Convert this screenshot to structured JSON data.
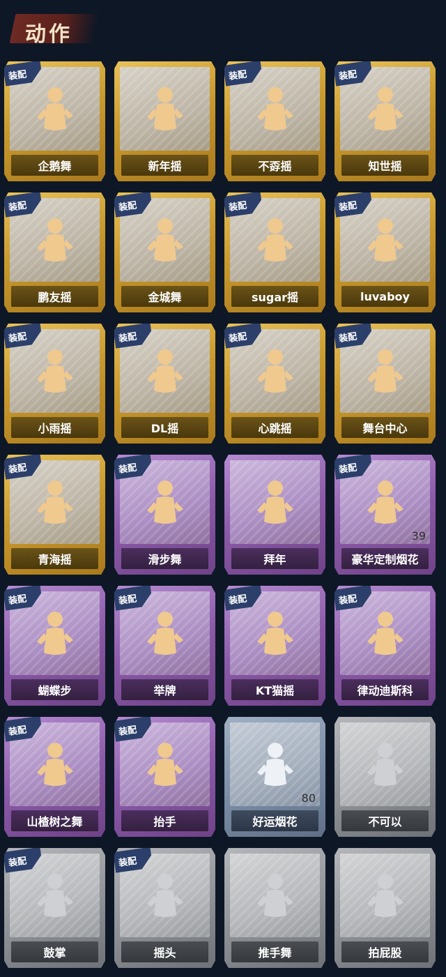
{
  "header": {
    "title": "动作"
  },
  "badge_text": "装配",
  "cards": [
    {
      "label": "企鹅舞",
      "rarity": "gold",
      "equipped": true,
      "count": ""
    },
    {
      "label": "新年摇",
      "rarity": "gold",
      "equipped": false,
      "count": ""
    },
    {
      "label": "不孬摇",
      "rarity": "gold",
      "equipped": true,
      "count": ""
    },
    {
      "label": "知世摇",
      "rarity": "gold",
      "equipped": true,
      "count": ""
    },
    {
      "label": "鹏友摇",
      "rarity": "gold",
      "equipped": true,
      "count": ""
    },
    {
      "label": "金城舞",
      "rarity": "gold",
      "equipped": true,
      "count": ""
    },
    {
      "label": "sugar摇",
      "rarity": "gold",
      "equipped": true,
      "count": ""
    },
    {
      "label": "luvaboy",
      "rarity": "gold",
      "equipped": true,
      "count": ""
    },
    {
      "label": "小雨摇",
      "rarity": "gold",
      "equipped": true,
      "count": ""
    },
    {
      "label": "DL摇",
      "rarity": "gold",
      "equipped": true,
      "count": ""
    },
    {
      "label": "心跳摇",
      "rarity": "gold",
      "equipped": true,
      "count": ""
    },
    {
      "label": "舞台中心",
      "rarity": "gold",
      "equipped": true,
      "count": ""
    },
    {
      "label": "青海摇",
      "rarity": "gold",
      "equipped": true,
      "count": ""
    },
    {
      "label": "滑步舞",
      "rarity": "purple",
      "equipped": true,
      "count": ""
    },
    {
      "label": "拜年",
      "rarity": "purple",
      "equipped": false,
      "count": ""
    },
    {
      "label": "豪华定制烟花",
      "rarity": "purple",
      "equipped": true,
      "count": "39"
    },
    {
      "label": "蝴蝶步",
      "rarity": "purple",
      "equipped": true,
      "count": ""
    },
    {
      "label": "举牌",
      "rarity": "purple",
      "equipped": true,
      "count": ""
    },
    {
      "label": "KT猫摇",
      "rarity": "purple",
      "equipped": true,
      "count": ""
    },
    {
      "label": "律动迪斯科",
      "rarity": "purple",
      "equipped": true,
      "count": ""
    },
    {
      "label": "山楂树之舞",
      "rarity": "purple",
      "equipped": true,
      "count": ""
    },
    {
      "label": "抬手",
      "rarity": "purple",
      "equipped": true,
      "count": ""
    },
    {
      "label": "好运烟花",
      "rarity": "blue",
      "equipped": false,
      "count": "80"
    },
    {
      "label": "不可以",
      "rarity": "gray",
      "equipped": false,
      "count": ""
    },
    {
      "label": "鼓掌",
      "rarity": "gray",
      "equipped": true,
      "count": ""
    },
    {
      "label": "摇头",
      "rarity": "gray",
      "equipped": true,
      "count": ""
    },
    {
      "label": "推手舞",
      "rarity": "gray",
      "equipped": false,
      "count": ""
    },
    {
      "label": "拍屁股",
      "rarity": "gray",
      "equipped": false,
      "count": ""
    }
  ]
}
